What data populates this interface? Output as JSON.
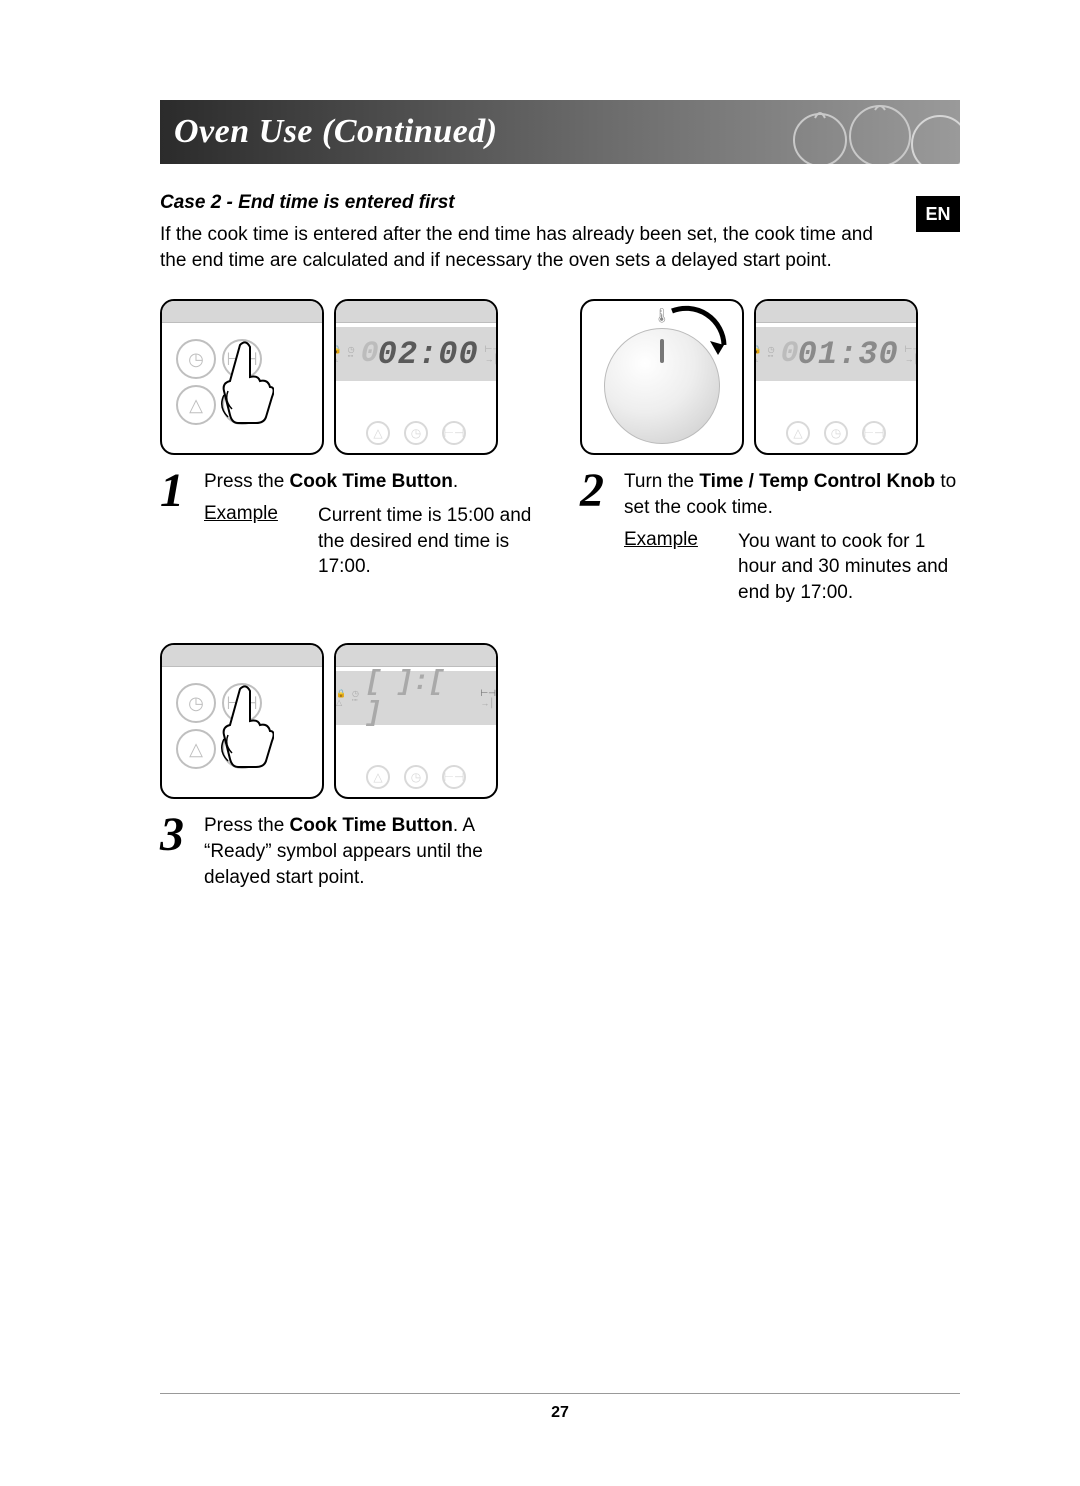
{
  "header": {
    "title": "Oven Use (Continued)"
  },
  "lang_badge": "EN",
  "case": {
    "title": "Case 2 - End time is entered first",
    "intro": "If the cook time is entered after the end time has already been set, the cook time and the end time are calculated and if necessary the oven sets a delayed start point."
  },
  "steps": [
    {
      "num": "1",
      "display_value": "02:00",
      "display_style": "bold",
      "panel_left": "control-press",
      "text_pre": "Press the ",
      "text_bold": "Cook Time Button",
      "text_post": ".",
      "example_label": "Example",
      "example_text": "Current time is 15:00 and the desired end time is 17:00."
    },
    {
      "num": "2",
      "display_value": "01:30",
      "display_style": "dim-first",
      "panel_left": "knob",
      "text_pre": "Turn the ",
      "text_bold": "Time / Temp Control Knob",
      "text_post": " to set the cook time.",
      "example_label": "Example",
      "example_text": "You want to cook for 1 hour and 30 minutes and end by 17:00."
    },
    {
      "num": "3",
      "display_value": "--:--",
      "display_style": "dashes",
      "panel_left": "control-press",
      "text_pre": "Press the ",
      "text_bold": "Cook Time Button",
      "text_post": ". A “Ready” symbol appears until the delayed start point.",
      "example_label": "",
      "example_text": ""
    }
  ],
  "page_number": "27",
  "icons": {
    "clock": "clock-icon",
    "cooktime": "cooktime-icon",
    "bell": "bell-icon",
    "arrow": "arrow-icon"
  }
}
